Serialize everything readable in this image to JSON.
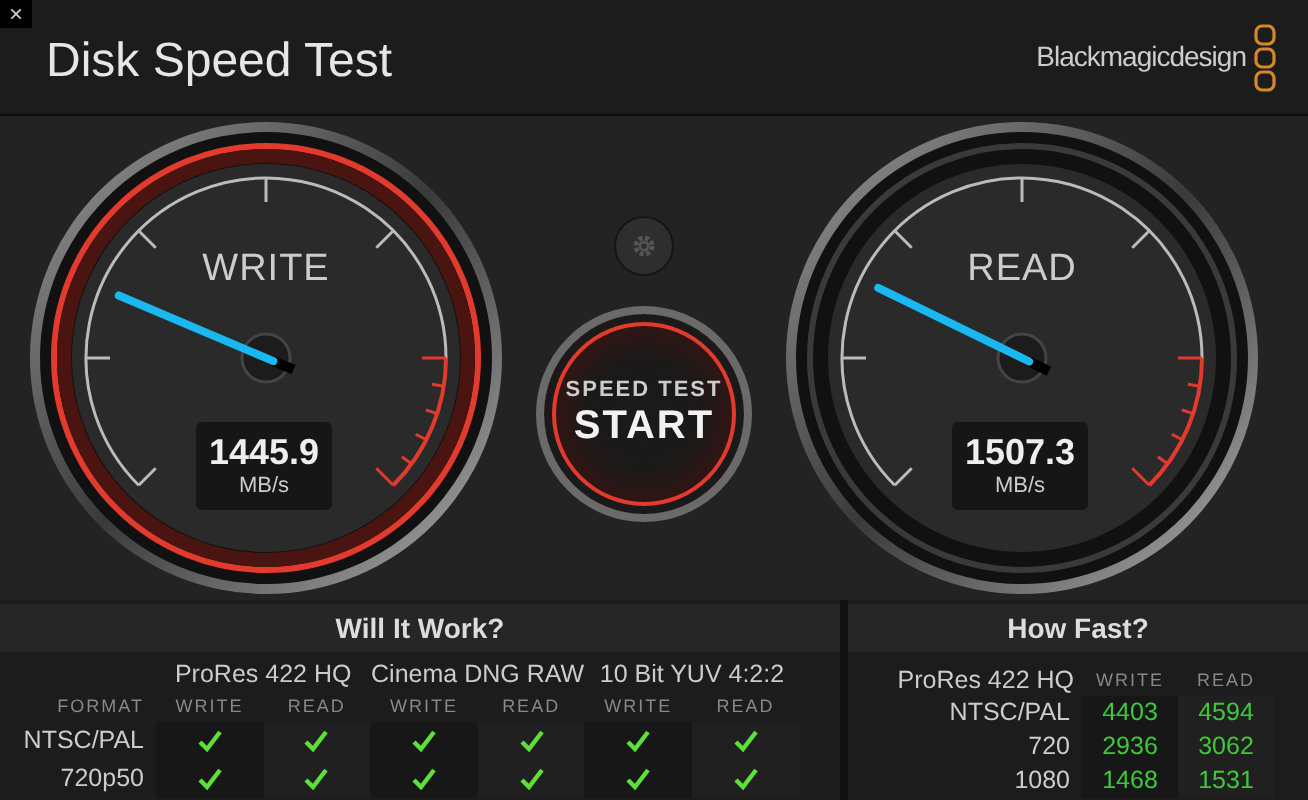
{
  "window": {
    "close": "×",
    "title": "Disk Speed Test",
    "brand": "Blackmagicdesign"
  },
  "gauges": [
    {
      "label": "WRITE",
      "value": "1445.9",
      "unit": "MB/s",
      "active": true
    },
    {
      "label": "READ",
      "value": "1507.3",
      "unit": "MB/s",
      "active": false
    }
  ],
  "start_button": {
    "caption": "SPEED TEST",
    "label": "START"
  },
  "will_it_work": {
    "title": "Will It Work?",
    "format_label": "FORMAT",
    "codecs": [
      {
        "name": "ProRes 422 HQ",
        "columns": [
          "WRITE",
          "READ"
        ]
      },
      {
        "name": "Cinema DNG RAW",
        "columns": [
          "WRITE",
          "READ"
        ]
      },
      {
        "name": "10 Bit YUV 4:2:2",
        "columns": [
          "WRITE",
          "READ"
        ]
      }
    ],
    "rows": [
      {
        "format": "NTSC/PAL",
        "results": [
          true,
          true,
          true,
          true,
          true,
          true
        ]
      },
      {
        "format": "720p50",
        "results": [
          true,
          true,
          true,
          true,
          true,
          true
        ]
      }
    ]
  },
  "how_fast": {
    "title": "How Fast?",
    "codec": "ProRes 422 HQ",
    "columns": [
      "WRITE",
      "READ"
    ],
    "rows": [
      {
        "format": "NTSC/PAL",
        "values": [
          "4403",
          "4594"
        ]
      },
      {
        "format": "720",
        "values": [
          "2936",
          "3062"
        ]
      },
      {
        "format": "1080",
        "values": [
          "1468",
          "1531"
        ]
      }
    ]
  }
}
